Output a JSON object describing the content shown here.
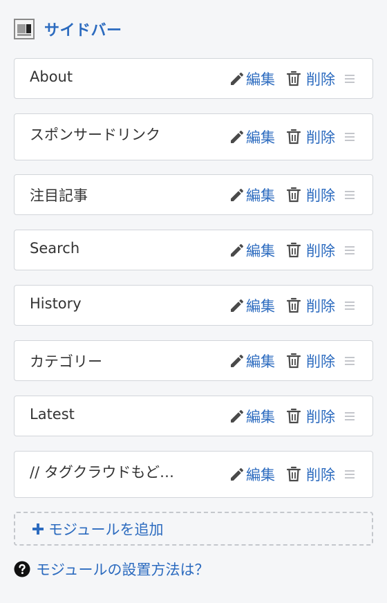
{
  "sidebar": {
    "title": "サイドバー",
    "icon": "sidebar-layout-icon"
  },
  "modules": [
    {
      "name": "About"
    },
    {
      "name": "スポンサードリンク"
    },
    {
      "name": "注目記事"
    },
    {
      "name": "Search"
    },
    {
      "name": "History"
    },
    {
      "name": "カテゴリー"
    },
    {
      "name": "Latest"
    },
    {
      "name": "// タグクラウドもど…"
    }
  ],
  "actions": {
    "edit_label": "編集",
    "edit_icon": "pencil-icon",
    "delete_label": "削除",
    "delete_icon": "trash-icon",
    "handle_icon": "drag-handle-icon"
  },
  "add_module": {
    "label": "モジュールを追加",
    "icon": "plus-icon"
  },
  "help": {
    "label": "モジュールの設置方法は？",
    "icon": "question-circle-icon"
  },
  "colors": {
    "accent": "#2c6bbf",
    "text": "#333333",
    "background": "#f5f6f8",
    "card_border": "#d2d5da",
    "handle": "#b0b4ba"
  }
}
